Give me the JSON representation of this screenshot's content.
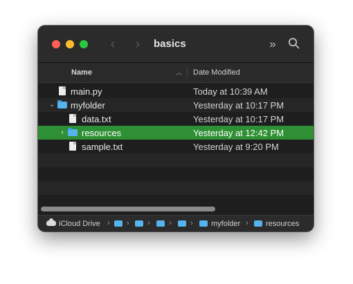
{
  "window": {
    "title": "basics"
  },
  "toolbar": {
    "back_icon": "chevron-left-icon",
    "forward_icon": "chevron-right-icon",
    "more_icon": "double-chevron-icon",
    "search_icon": "search-icon"
  },
  "columns": {
    "name": "Name",
    "date_modified": "Date Modified"
  },
  "files": [
    {
      "name": "main.py",
      "date": "Today at 10:39 AM",
      "kind": "file"
    },
    {
      "name": "myfolder",
      "date": "Yesterday at 10:17 PM",
      "kind": "folder",
      "expanded": true
    },
    {
      "name": "data.txt",
      "date": "Yesterday at 10:17 PM",
      "kind": "file"
    },
    {
      "name": "resources",
      "date": "Yesterday at 12:42 PM",
      "kind": "folder",
      "selected": true
    },
    {
      "name": "sample.txt",
      "date": "Yesterday at 9:20 PM",
      "kind": "file"
    }
  ],
  "pathbar": {
    "root": "iCloud Drive",
    "folder1": "myfolder",
    "folder2": "resources"
  },
  "colors": {
    "selection": "#2f8f34",
    "folder": "#56b3ee"
  }
}
